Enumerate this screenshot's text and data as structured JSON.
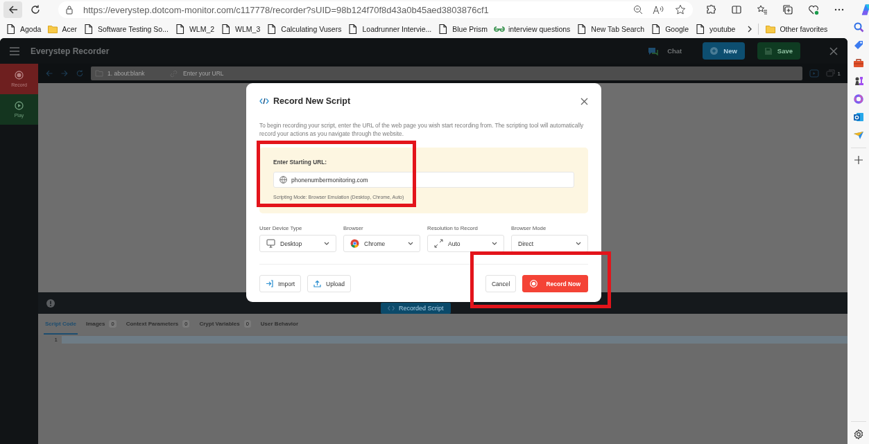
{
  "browser": {
    "url": "https://everystep.dotcom-monitor.com/c117778/recorder?sUID=98b124f70f8d43a0b45aed3803876cf1",
    "bookmarks": [
      {
        "label": "Agoda",
        "kind": "page"
      },
      {
        "label": "Acer",
        "kind": "folder"
      },
      {
        "label": "Software Testing So...",
        "kind": "page"
      },
      {
        "label": "WLM_2",
        "kind": "page"
      },
      {
        "label": "WLM_3",
        "kind": "page"
      },
      {
        "label": "Calculating Vusers",
        "kind": "page"
      },
      {
        "label": "Loadrunner Intervie...",
        "kind": "page"
      },
      {
        "label": "Blue Prism",
        "kind": "page"
      },
      {
        "label": "interview questions",
        "kind": "gfg"
      },
      {
        "label": "New Tab Search",
        "kind": "page"
      },
      {
        "label": "Google",
        "kind": "page"
      },
      {
        "label": "youtube",
        "kind": "page"
      }
    ],
    "other_favorites": "Other favorites"
  },
  "app": {
    "title": "Everystep Recorder",
    "chat": "Chat",
    "new_button": "New",
    "save_button": "Save",
    "rail": [
      {
        "label": "Record",
        "kind": "record",
        "selected": true
      },
      {
        "label": "Play",
        "kind": "play",
        "selected": false
      }
    ],
    "nav": {
      "step": "1. about:blank",
      "url_placeholder": "Enter your URL",
      "count": "1"
    },
    "recorded_script": "Recorded Script",
    "tabs": [
      {
        "label": "Script Code",
        "selected": true
      },
      {
        "label": "Images",
        "count": "0",
        "selected": false
      },
      {
        "label": "Context Parameters",
        "count": "0",
        "selected": false
      },
      {
        "label": "Crypt Variables",
        "count": "0",
        "selected": false
      },
      {
        "label": "User Behavior",
        "selected": false
      }
    ],
    "line_number": "1"
  },
  "dialog": {
    "title": "Record New Script",
    "intro": "To begin recording your script, enter the URL of the web page you wish start recording from. The scripting tool will automatically record your actions as you navigate through the website.",
    "url_label": "Enter Starting URL:",
    "url_value": "phonenumbermonitoring.com",
    "scripting_mode": "Scripting Mode: Browser Emulation (Desktop, Chrome, Auto)",
    "selects": [
      {
        "label": "User Device Type",
        "value": "Desktop",
        "kind": "desktop"
      },
      {
        "label": "Browser",
        "value": "Chrome",
        "kind": "chrome"
      },
      {
        "label": "Resolution to Record",
        "value": "Auto",
        "kind": "resize"
      },
      {
        "label": "Browser Mode",
        "value": "Direct",
        "kind": "plain"
      }
    ],
    "buttons": [
      {
        "label": "Import",
        "kind": "import"
      },
      {
        "label": "Upload",
        "kind": "upload"
      },
      {
        "label": "Cancel",
        "kind": "cancel"
      },
      {
        "label": "Record Now",
        "kind": "record"
      }
    ]
  }
}
